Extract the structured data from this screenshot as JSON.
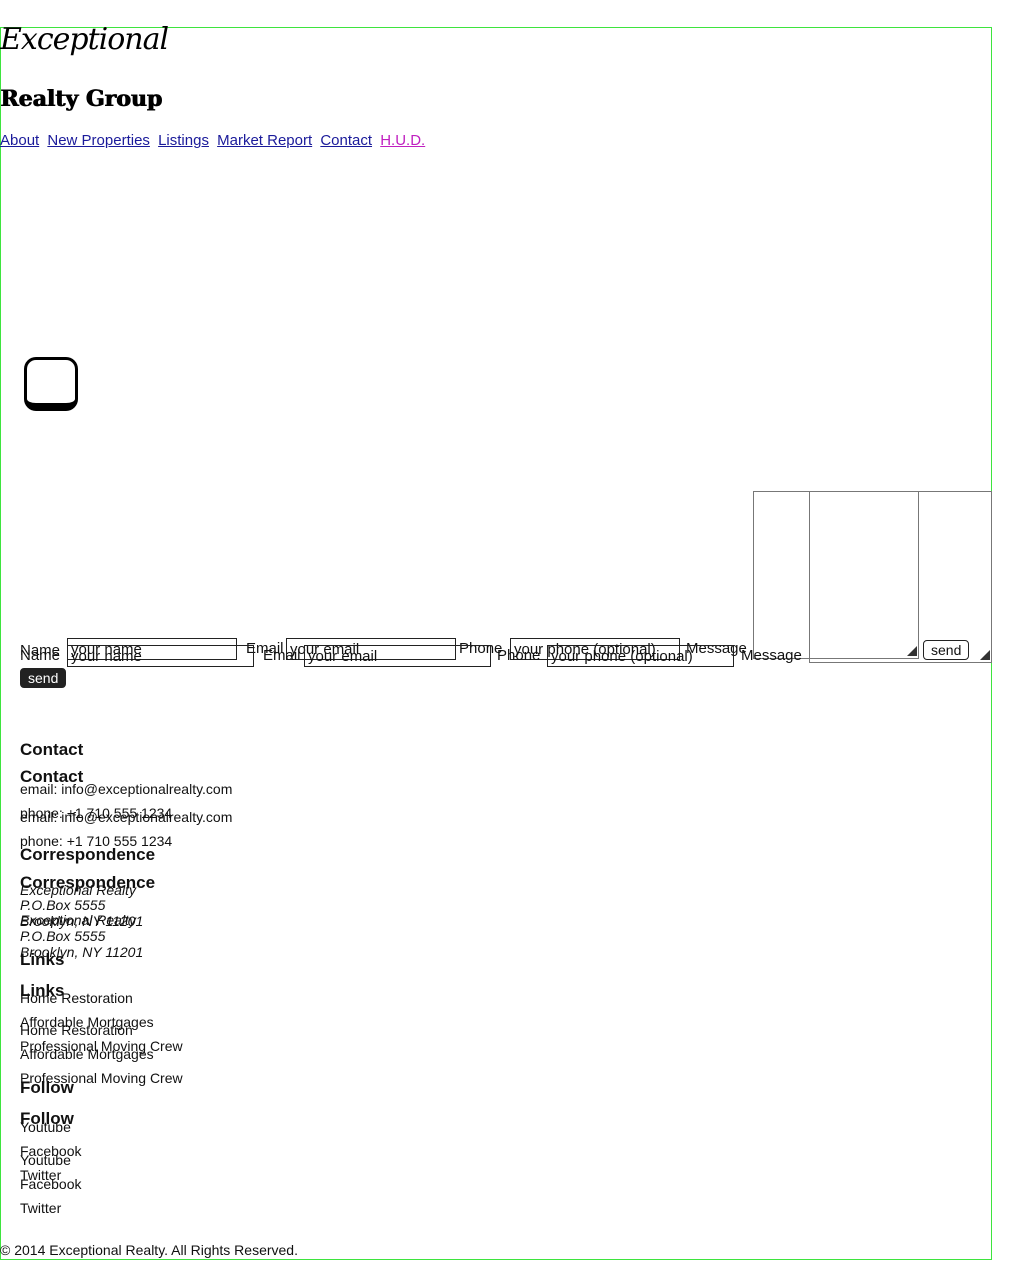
{
  "brand": {
    "script": "Exceptional",
    "sub": "Realty Group"
  },
  "nav": [
    "About",
    "New Properties",
    "Listings",
    "Market Report",
    "Contact",
    "H.U.D."
  ],
  "form": {
    "name_label": "Name",
    "name_placeholder": "your name",
    "email_label": "Email",
    "email_placeholder": "your email",
    "phone_label": "Phone",
    "phone_placeholder": "your phone (optional)",
    "message_label": "Message",
    "send": "send"
  },
  "contact": {
    "heading": "Contact",
    "email": "email: info@exceptionalrealty.com",
    "phone": "phone: +1 710 555 1234"
  },
  "correspondence": {
    "heading": "Correspondence",
    "lines": [
      "Exceptional Realty",
      "P.O.Box 5555",
      "Brooklyn, NY 11201"
    ]
  },
  "links": {
    "heading": "Links",
    "items": [
      "Home Restoration",
      "Affordable Mortgages",
      "Professional Moving Crew"
    ]
  },
  "follow": {
    "heading": "Follow",
    "items": [
      "Youtube",
      "Facebook",
      "Twitter"
    ]
  },
  "copyright": "© 2014 Exceptional Realty. All Rights Reserved.",
  "colors": {
    "frame": "#3ee43e",
    "link": "#1a1a9a",
    "link_current": "#c020c0"
  }
}
